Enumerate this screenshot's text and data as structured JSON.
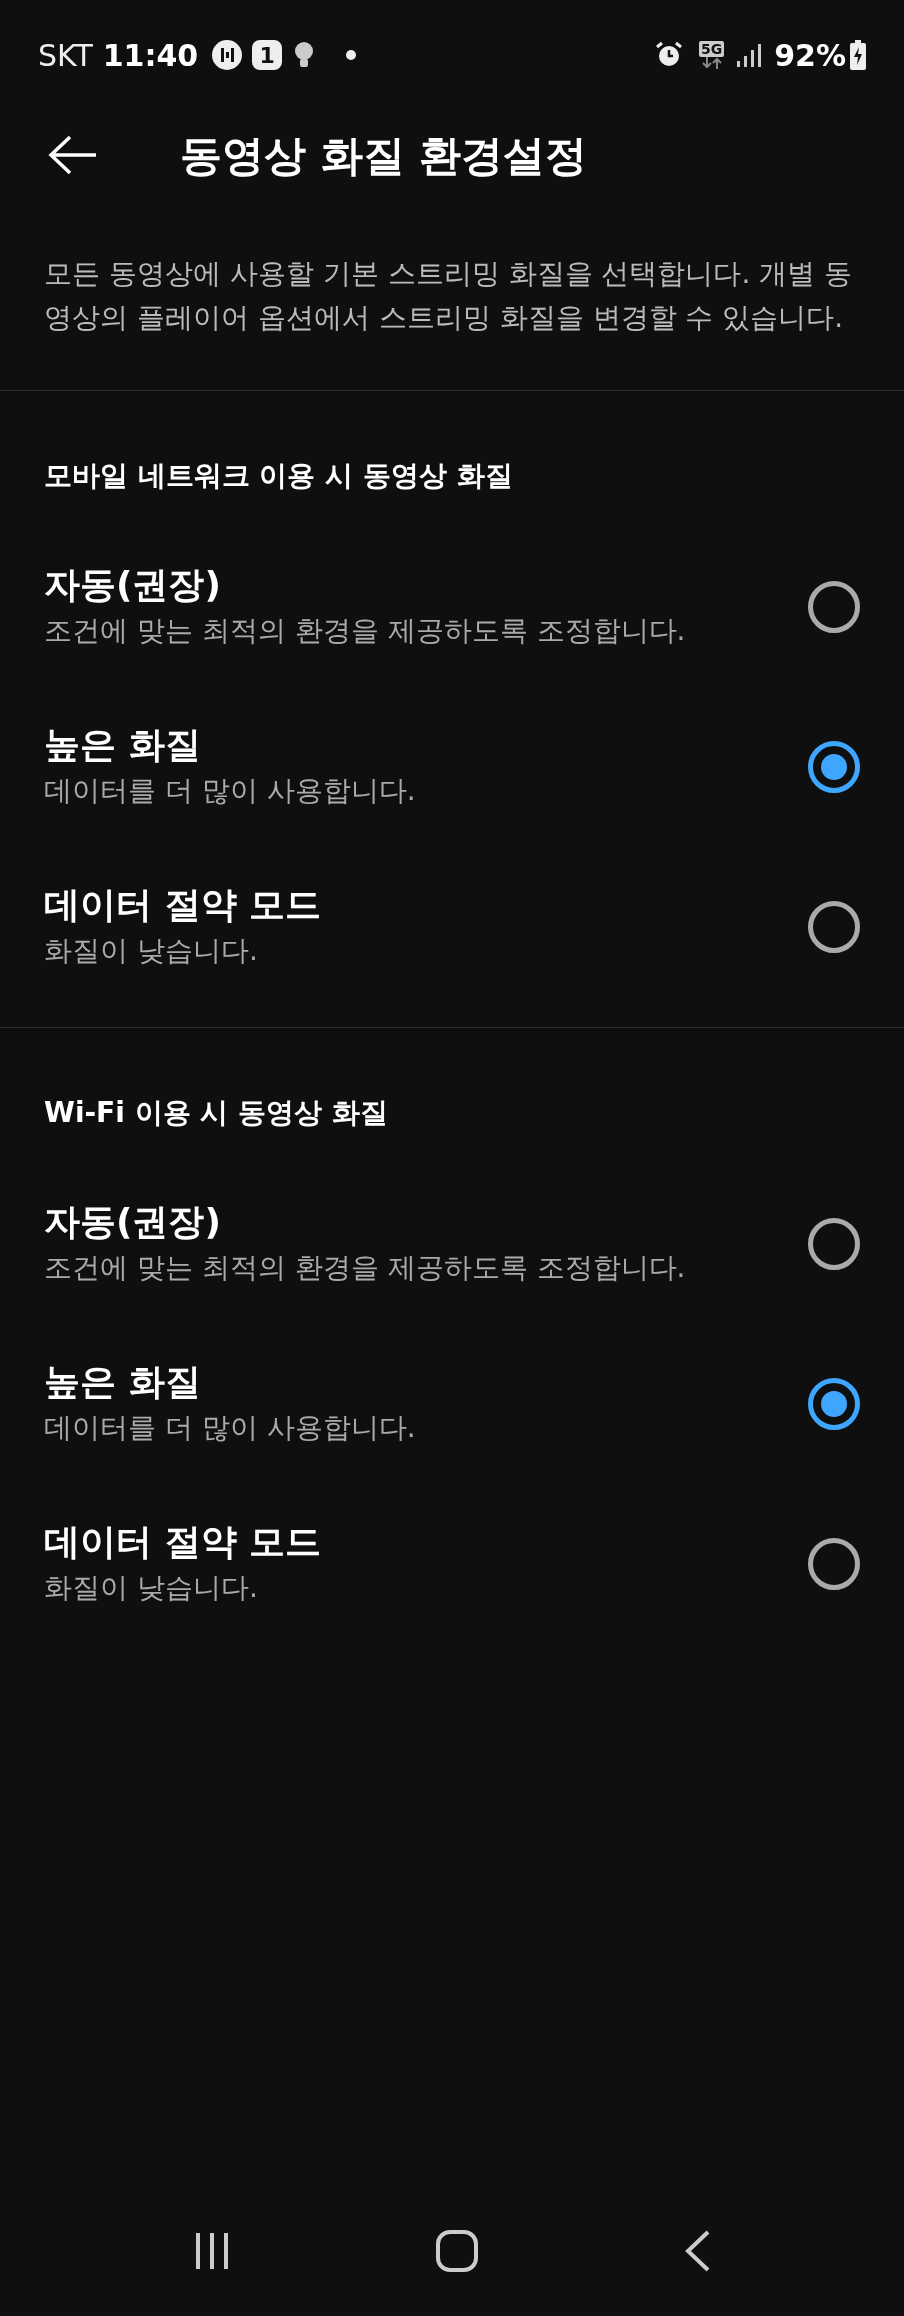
{
  "status_bar": {
    "carrier": "SKT",
    "time": "11:40",
    "badge": "1",
    "network": "5G",
    "battery": "92%"
  },
  "header": {
    "title": "동영상 화질 환경설정"
  },
  "description": "모든 동영상에 사용할 기본 스트리밍 화질을 선택합니다. 개별 동영상의 플레이어 옵션에서 스트리밍 화질을 변경할 수 있습니다.",
  "sections": [
    {
      "title": "모바일 네트워크 이용 시 동영상 화질",
      "options": [
        {
          "label": "자동(권장)",
          "description": "조건에 맞는 최적의 환경을 제공하도록 조정합니다.",
          "selected": false
        },
        {
          "label": "높은 화질",
          "description": "데이터를 더 많이 사용합니다.",
          "selected": true
        },
        {
          "label": "데이터 절약 모드",
          "description": "화질이 낮습니다.",
          "selected": false
        }
      ]
    },
    {
      "title": "Wi-Fi 이용 시 동영상 화질",
      "options": [
        {
          "label": "자동(권장)",
          "description": "조건에 맞는 최적의 환경을 제공하도록 조정합니다.",
          "selected": false
        },
        {
          "label": "높은 화질",
          "description": "데이터를 더 많이 사용합니다.",
          "selected": true
        },
        {
          "label": "데이터 절약 모드",
          "description": "화질이 낮습니다.",
          "selected": false
        }
      ]
    }
  ]
}
